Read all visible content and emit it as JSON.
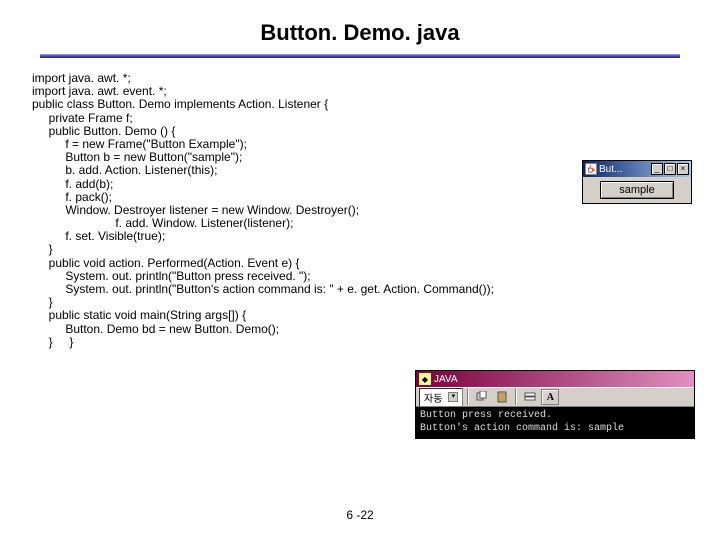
{
  "title": "Button. Demo. java",
  "page_number": "6 -22",
  "code": "import java. awt. *;\nimport java. awt. event. *;\npublic class Button. Demo implements Action. Listener {\n     private Frame f;\n     public Button. Demo () {\n          f = new Frame(\"Button Example\");\n          Button b = new Button(\"sample\");\n          b. add. Action. Listener(this);\n          f. add(b);\n          f. pack();\n          Window. Destroyer listener = new Window. Destroyer();\n                         f. add. Window. Listener(listener);\n          f. set. Visible(true);\n     }\n     public void action. Performed(Action. Event e) {\n          System. out. println(\"Button press received. \");\n          System. out. println(\"Button's action command is: \" + e. get. Action. Command());\n     }\n     public static void main(String args[]) {\n          Button. Demo bd = new Button. Demo();\n     }     }",
  "awt": {
    "title": "But...",
    "button_label": "sample"
  },
  "java_console": {
    "title": "JAVA",
    "combo": "자동",
    "output": "Button press received.\nButton's action command is: sample"
  }
}
